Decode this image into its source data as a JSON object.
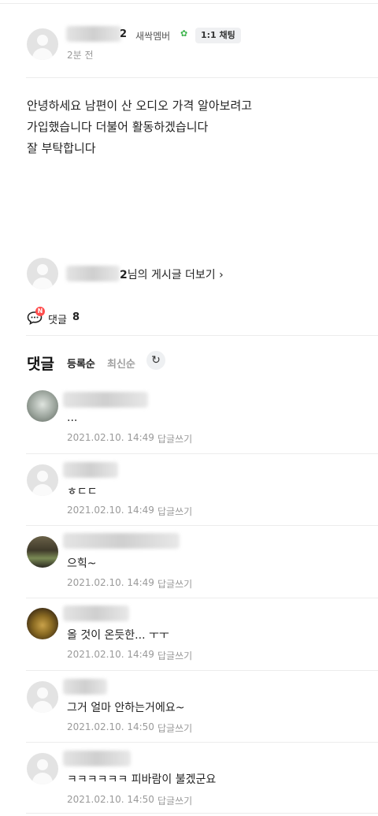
{
  "post": {
    "author_suffix": "2",
    "member_grade": "새싹멤버",
    "grade_icon": "sprout-icon",
    "chat_label": "1:1 채팅",
    "time": "2분 전",
    "body_lines": [
      "안녕하세요 남편이 산 오디오 가격 알아보려고",
      "가입했습니다 더불어 활동하겠습니다",
      "잘 부탁합니다"
    ]
  },
  "author_more": {
    "nick_suffix": "2",
    "label": "님의 게시글 더보기 ›"
  },
  "comment_summary": {
    "badge": "N",
    "label": "댓글",
    "count": "8"
  },
  "comments_section": {
    "title": "댓글",
    "sort_registered": "등록순",
    "sort_latest": "최신순",
    "refresh_icon": "refresh-icon"
  },
  "comments": [
    {
      "text": "...",
      "date": "2021.02.10. 14:49",
      "reply": "답글쓰기"
    },
    {
      "text": "ㅎㄷㄷ",
      "date": "2021.02.10. 14:49",
      "reply": "답글쓰기"
    },
    {
      "text": "으힉~",
      "date": "2021.02.10. 14:49",
      "reply": "답글쓰기"
    },
    {
      "text": "올 것이 온듯한... ㅜㅜ",
      "date": "2021.02.10. 14:49",
      "reply": "답글쓰기"
    },
    {
      "text": "그거 얼마 안하는거에요~",
      "date": "2021.02.10. 14:50",
      "reply": "답글쓰기"
    },
    {
      "text": "ㅋㅋㅋㅋㅋㅋ 피바람이 불겠군요",
      "date": "2021.02.10. 14:50",
      "reply": "답글쓰기"
    }
  ],
  "colors": {
    "text": "#222222",
    "muted": "#9a9a9a",
    "badge": "#ff4d4d",
    "sprout": "#3cb44b",
    "divider": "#ececec"
  }
}
